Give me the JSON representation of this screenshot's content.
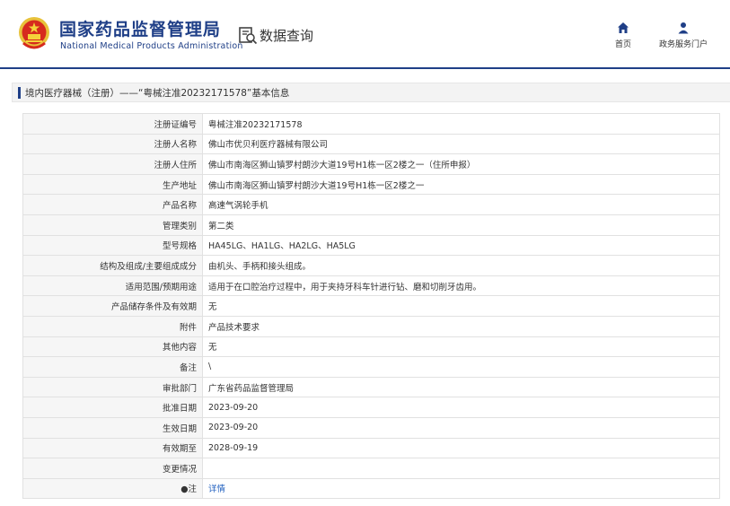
{
  "header": {
    "agency_cn": "国家药品监督管理局",
    "agency_en": "National Medical Products Administration",
    "query_title": "数据查询",
    "nav": [
      {
        "label": "首页",
        "icon": "home-icon"
      },
      {
        "label": "政务服务门户",
        "icon": "user-icon"
      }
    ],
    "brand_color": "#1f3f87"
  },
  "breadcrumb": {
    "text": "境内医疗器械（注册）——“粤械注准20232171578”基本信息"
  },
  "table": {
    "rows": [
      {
        "key": "注册证编号",
        "value": "粤械注准20232171578"
      },
      {
        "key": "注册人名称",
        "value": "佛山市优贝利医疗器械有限公司"
      },
      {
        "key": "注册人住所",
        "value": "佛山市南海区狮山镇罗村朗沙大道19号H1栋一区2楼之一（住所申报）"
      },
      {
        "key": "生产地址",
        "value": "佛山市南海区狮山镇罗村朗沙大道19号H1栋一区2楼之一"
      },
      {
        "key": "产品名称",
        "value": "高速气涡轮手机"
      },
      {
        "key": "管理类别",
        "value": "第二类"
      },
      {
        "key": "型号规格",
        "value": "HA45LG、HA1LG、HA2LG、HA5LG"
      },
      {
        "key": "结构及组成/主要组成成分",
        "value": "由机头、手柄和接头组成。"
      },
      {
        "key": "适用范围/预期用途",
        "value": "适用于在口腔治疗过程中，用于夹持牙科车针进行钻、磨和切削牙齿用。"
      },
      {
        "key": "产品储存条件及有效期",
        "value": "无"
      },
      {
        "key": "附件",
        "value": "产品技术要求"
      },
      {
        "key": "其他内容",
        "value": "无"
      },
      {
        "key": "备注",
        "value": "\\"
      },
      {
        "key": "审批部门",
        "value": "广东省药品监督管理局"
      },
      {
        "key": "批准日期",
        "value": "2023-09-20"
      },
      {
        "key": "生效日期",
        "value": "2023-09-20"
      },
      {
        "key": "有效期至",
        "value": "2028-09-19"
      },
      {
        "key": "变更情况",
        "value": ""
      }
    ],
    "note_key": "注",
    "note_bullet": "●",
    "note_link": "详情"
  }
}
